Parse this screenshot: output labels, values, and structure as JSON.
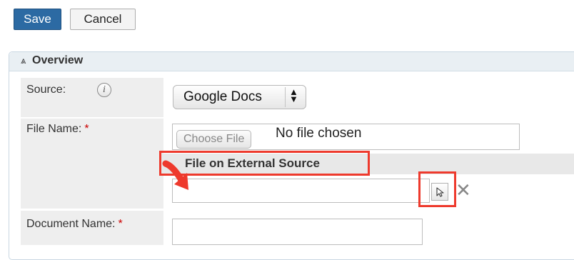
{
  "toolbar": {
    "save_label": "Save",
    "cancel_label": "Cancel"
  },
  "panel": {
    "title": "Overview",
    "collapse_icon": "chevrons-up-icon"
  },
  "fields": {
    "source": {
      "label": "Source:",
      "info_glyph": "i",
      "selected": "Google Docs"
    },
    "file_name": {
      "label": "File Name:",
      "required": "*",
      "choose_label": "Choose File",
      "status": "No file chosen"
    },
    "external": {
      "label": "File on External Source",
      "value": ""
    },
    "document_name": {
      "label": "Document Name:",
      "required": "*",
      "value": ""
    }
  },
  "colors": {
    "accent": "#2c6aa3",
    "highlight": "#ee3a2d",
    "required": "#cc0000"
  }
}
